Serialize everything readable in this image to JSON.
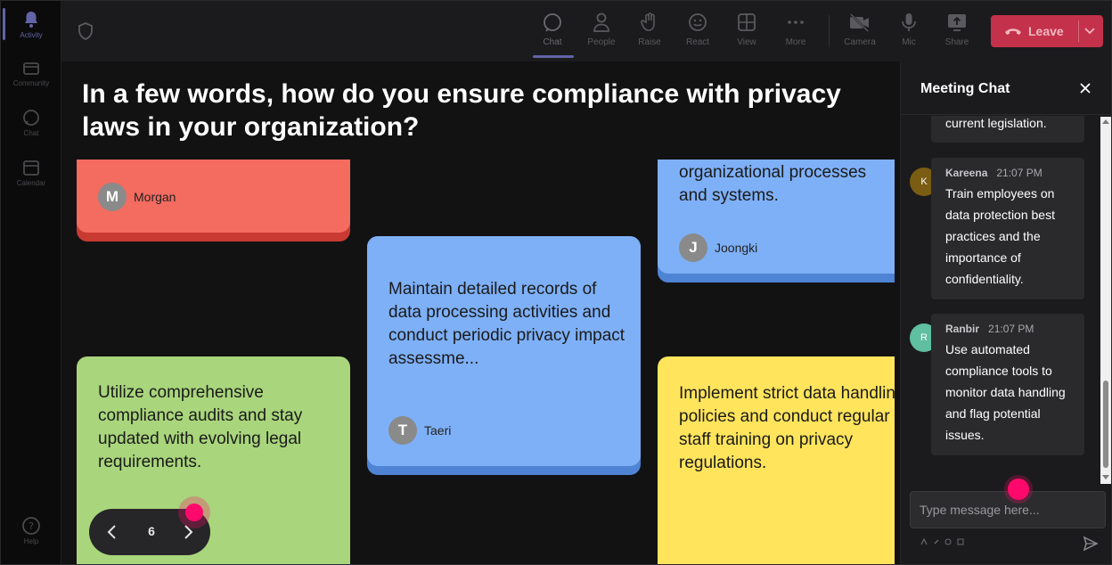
{
  "rail": {
    "items": [
      {
        "label": "Activity"
      },
      {
        "label": "Community"
      },
      {
        "label": "Chat"
      },
      {
        "label": "Calendar"
      },
      {
        "label": "Help"
      }
    ]
  },
  "toolbar": {
    "chat": "Chat",
    "people": "People",
    "raise": "Raise",
    "react": "React",
    "view": "View",
    "more": "More",
    "camera": "Camera",
    "mic": "Mic",
    "share": "Share",
    "leave": "Leave"
  },
  "stage": {
    "question": "In a few words, how do you ensure compliance with privacy laws in your organization?",
    "cards": [
      {
        "text": "",
        "author": "Morgan",
        "initial": "M",
        "color": "#f46b60",
        "shade": "#c83a32"
      },
      {
        "text": "principles in all organizational processes and systems.",
        "author": "Joongki",
        "initial": "J",
        "color": "#7eb0f7",
        "shade": "#4f83d4"
      },
      {
        "text": "Maintain detailed records of data processing activities and conduct periodic privacy impact assessme...",
        "author": "Taeri",
        "initial": "T",
        "color": "#7eb0f7",
        "shade": "#4f83d4"
      },
      {
        "text": "Utilize comprehensive compliance audits and stay updated with evolving legal requirements.",
        "author": "",
        "initial": "",
        "color": "#a9d57c",
        "shade": "#7fb155"
      },
      {
        "text": "Implement strict data handling policies and conduct regular staff training on privacy regulations.",
        "author": "",
        "initial": "",
        "color": "#ffe45c",
        "shade": "#d7b92e"
      }
    ],
    "page": "6"
  },
  "chat": {
    "title": "Meeting Chat",
    "messages": [
      {
        "sender": "",
        "time": "",
        "text": "current legislation."
      },
      {
        "sender": "Kareena",
        "time": "21:07 PM",
        "text": "Train employees on data protection best practices and the importance of confidentiality.",
        "initial": "K",
        "avatar_color": "#7a5c12"
      },
      {
        "sender": "Ranbir",
        "time": "21:07 PM",
        "text": "Use automated compliance tools to monitor data handling and flag potential issues.",
        "initial": "R",
        "avatar_color": "#5fbfa0"
      }
    ],
    "input_placeholder": "Type message here..."
  }
}
